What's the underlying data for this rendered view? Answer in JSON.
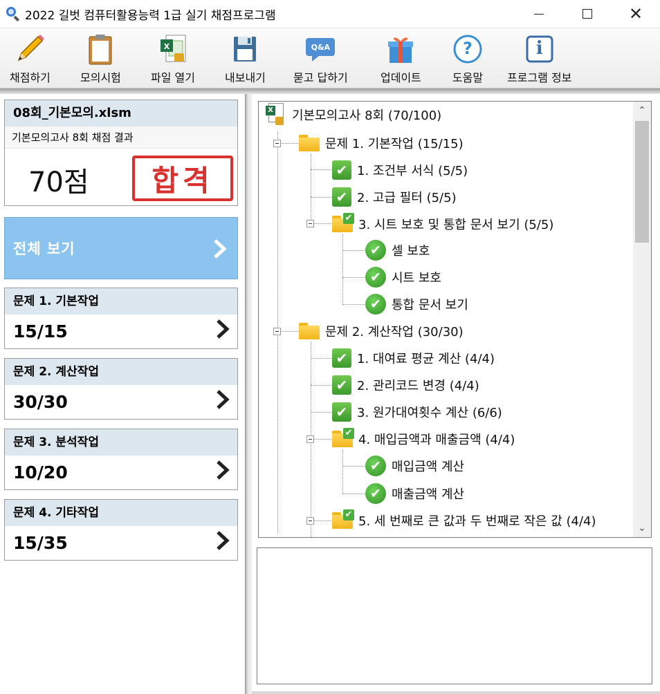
{
  "window": {
    "title": "2022 길벗 컴퓨터활용능력 1급 실기 채점프로그램",
    "controls": {
      "minimize": "minimize-icon",
      "maximize": "maximize-icon",
      "close": "✕"
    }
  },
  "toolbar": {
    "items": [
      {
        "label": "채점하기",
        "icon": "pencil-icon"
      },
      {
        "label": "모의시험",
        "icon": "clipboard-icon"
      },
      {
        "label": "파일 열기",
        "icon": "excel-file-icon"
      },
      {
        "label": "내보내기",
        "icon": "floppy-disk-icon"
      },
      {
        "label": "묻고 답하기",
        "icon": "qa-bubble-icon"
      },
      {
        "label": "업데이트",
        "icon": "gift-box-icon"
      },
      {
        "label": "도움말",
        "icon": "help-icon"
      },
      {
        "label": "프로그램 정보",
        "icon": "info-icon"
      }
    ],
    "qa_badge": "Q&A",
    "help_glyph": "?",
    "info_glyph": "i"
  },
  "result": {
    "file_name": "08회_기본모의.xlsm",
    "subtitle": "기본모의고사 8회 채점 결과",
    "score": "70점",
    "stamp": "합격",
    "stamp_color": "#d9322e"
  },
  "view_all": {
    "label": "전체 보기",
    "color": "#8bc4ef"
  },
  "sections": [
    {
      "title": "문제 1. 기본작업",
      "score": "15/15"
    },
    {
      "title": "문제 2. 계산작업",
      "score": "30/30"
    },
    {
      "title": "문제 3. 분석작업",
      "score": "10/20"
    },
    {
      "title": "문제 4. 기타작업",
      "score": "15/35"
    }
  ],
  "tree": {
    "root": "기본모의고사 8회 (70/100)",
    "nodes": [
      {
        "text": "문제 1. 기본작업 (15/15)",
        "icon": "folder-icon"
      },
      {
        "text": "1. 조건부 서식 (5/5)",
        "icon": "check-square-icon"
      },
      {
        "text": "2. 고급 필터 (5/5)",
        "icon": "check-square-icon"
      },
      {
        "text": "3. 시트 보호 및 통합 문서 보기 (5/5)",
        "icon": "folder-check-icon"
      },
      {
        "text": "셀 보호",
        "icon": "check-circle-icon"
      },
      {
        "text": "시트 보호",
        "icon": "check-circle-icon"
      },
      {
        "text": "통합 문서 보기",
        "icon": "check-circle-icon"
      },
      {
        "text": "문제 2. 계산작업 (30/30)",
        "icon": "folder-icon"
      },
      {
        "text": "1. 대여료 평균 계산 (4/4)",
        "icon": "check-square-icon"
      },
      {
        "text": "2. 관리코드 변경 (4/4)",
        "icon": "check-square-icon"
      },
      {
        "text": "3. 원가대여횟수 계산 (6/6)",
        "icon": "check-square-icon"
      },
      {
        "text": "4. 매입금액과 매출금액 (4/4)",
        "icon": "folder-check-icon"
      },
      {
        "text": "매입금액 계산",
        "icon": "check-circle-icon"
      },
      {
        "text": "매출금액 계산",
        "icon": "check-circle-icon"
      },
      {
        "text": "5. 세 번째로 큰 값과 두 번째로 작은 값 (4/4)",
        "icon": "folder-check-icon"
      }
    ],
    "check_glyph": "✔"
  },
  "scrollbar": {
    "up": "⌃",
    "down": "⌄"
  }
}
